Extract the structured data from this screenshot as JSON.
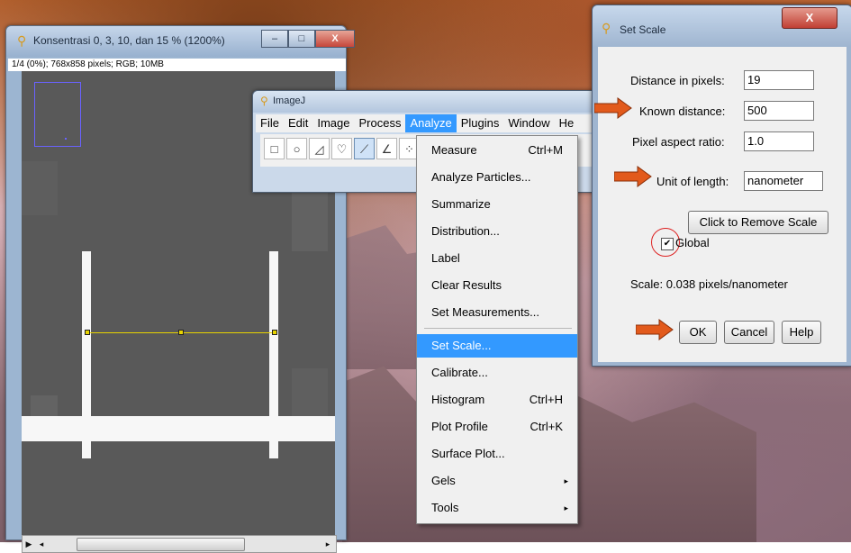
{
  "image_window": {
    "title": "Konsentrasi 0, 3, 10, dan 15 % (1200%)",
    "info": "1/4 (0%); 768x858 pixels; RGB; 10MB",
    "buttons": [
      "–",
      "□",
      "X"
    ]
  },
  "imagej": {
    "title": "ImageJ",
    "menus": [
      "File",
      "Edit",
      "Image",
      "Process",
      "Analyze",
      "Plugins",
      "Window",
      "He"
    ],
    "active_menu": "Analyze"
  },
  "analyze_menu": {
    "items": [
      {
        "label": "Measure",
        "shortcut": "Ctrl+M"
      },
      {
        "label": "Analyze Particles...",
        "shortcut": ""
      },
      {
        "label": "Summarize",
        "shortcut": ""
      },
      {
        "label": "Distribution...",
        "shortcut": ""
      },
      {
        "label": "Label",
        "shortcut": ""
      },
      {
        "label": "Clear Results",
        "shortcut": ""
      },
      {
        "label": "Set Measurements...",
        "shortcut": ""
      },
      {
        "label": "Set Scale...",
        "shortcut": ""
      },
      {
        "label": "Calibrate...",
        "shortcut": ""
      },
      {
        "label": "Histogram",
        "shortcut": "Ctrl+H"
      },
      {
        "label": "Plot Profile",
        "shortcut": "Ctrl+K"
      },
      {
        "label": "Surface Plot...",
        "shortcut": ""
      },
      {
        "label": "Gels",
        "shortcut": ""
      },
      {
        "label": "Tools",
        "shortcut": ""
      }
    ],
    "highlighted": "Set Scale...",
    "arrow": "▸"
  },
  "set_scale": {
    "title": "Set Scale",
    "close": "X",
    "labels": {
      "distance_pixels": "Distance in pixels:",
      "known_distance": "Known distance:",
      "pixel_aspect": "Pixel aspect ratio:",
      "unit": "Unit of length:"
    },
    "values": {
      "distance_pixels": "19",
      "known_distance": "500",
      "pixel_aspect": "1.0",
      "unit": "nanometer"
    },
    "remove_scale": "Click to Remove Scale",
    "global_label": "Global",
    "global_checked": true,
    "checkmark": "✔",
    "scale_text": "Scale: 0.038 pixels/nanometer",
    "ok": "OK",
    "cancel": "Cancel",
    "help": "Help"
  },
  "colors": {
    "highlight": "#3399ff",
    "annotation_arrow": "#e25a1c",
    "annotation_circle": "#dd2222",
    "line_selection": "#e8d400"
  }
}
